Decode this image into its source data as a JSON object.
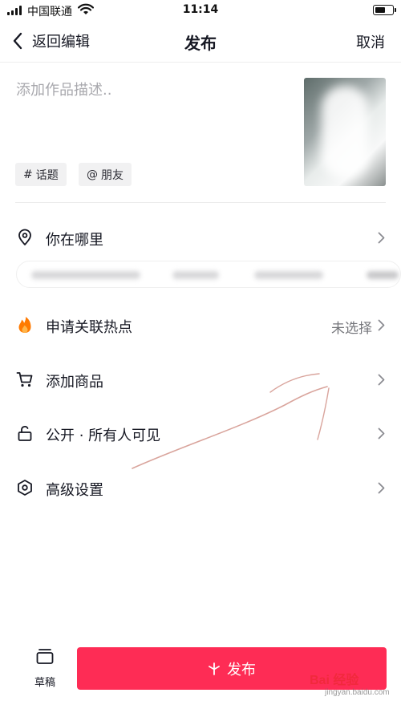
{
  "status_bar": {
    "carrier": "中国联通",
    "time": "11:14",
    "battery_level": 0.65
  },
  "nav": {
    "back_label": "返回编辑",
    "title": "发布",
    "cancel_label": "取消"
  },
  "composer": {
    "description_placeholder": "添加作品描述..",
    "topic_chip": {
      "symbol": "#",
      "label": "话题"
    },
    "friend_chip": {
      "symbol": "@",
      "label": "朋友"
    }
  },
  "settings": {
    "location": {
      "label": "你在哪里",
      "icon": "location-pin-icon"
    },
    "hotspot": {
      "label": "申请关联热点",
      "value": "未选择",
      "icon": "flame-icon"
    },
    "product": {
      "label": "添加商品",
      "icon": "cart-icon"
    },
    "visibility": {
      "label": "公开 · 所有人可见",
      "icon": "unlock-icon"
    },
    "advanced": {
      "label": "高级设置",
      "icon": "hexagon-settings-icon"
    }
  },
  "footer": {
    "draft_label": "草稿",
    "publish_label": "发布"
  },
  "watermark": {
    "brand": "Bai 经验",
    "domain": "jingyan.baidu.com"
  },
  "colors": {
    "accent": "#fe2c55",
    "text": "#161823",
    "muted": "#a8a8ad",
    "flame": "#ff7a00"
  }
}
